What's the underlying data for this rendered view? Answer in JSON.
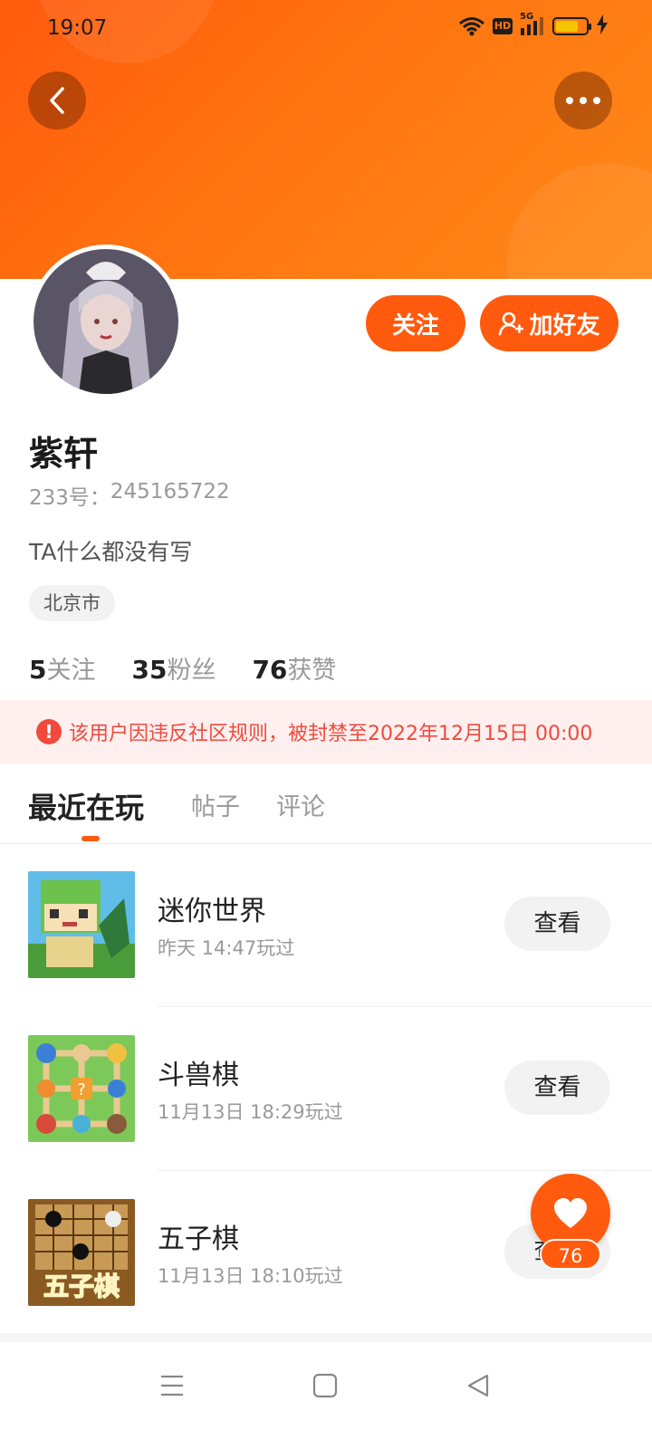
{
  "status_bar": {
    "time": "19:07",
    "network": "5G",
    "hd_label": "HD",
    "battery_level": 0.75,
    "icons": [
      "wifi-icon",
      "hd-icon",
      "signal-icon",
      "battery-icon",
      "charging-icon"
    ]
  },
  "header": {
    "back_icon": "chevron-left-icon",
    "more_icon": "more-dots-icon"
  },
  "profile": {
    "nickname": "紫轩",
    "uid_label": "233号：",
    "uid_value": "245165722",
    "bio": "TA什么都没有写",
    "location": "北京市",
    "follow_label": "关注",
    "add_friend_label": "加好友",
    "add_friend_icon": "add-user-icon"
  },
  "stats": [
    {
      "num": "5",
      "label": "关注"
    },
    {
      "num": "35",
      "label": "粉丝"
    },
    {
      "num": "76",
      "label": "获赞"
    }
  ],
  "ban_notice": {
    "icon": "alert-icon",
    "icon_glyph": "!",
    "text": "该用户因违反社区规则，被封禁至2022年12月15日 00:00"
  },
  "tabs": [
    {
      "label": "最近在玩",
      "active": true
    },
    {
      "label": "帖子",
      "active": false
    },
    {
      "label": "评论",
      "active": false
    }
  ],
  "games": [
    {
      "name": "迷你世界",
      "time": "昨天 14:47玩过",
      "button": "查看"
    },
    {
      "name": "斗兽棋",
      "time": "11月13日 18:29玩过",
      "button": "查看"
    },
    {
      "name": "五子棋",
      "time": "11月13日 18:10玩过",
      "button": "查看"
    }
  ],
  "gomoku_logo_text": "五子棋",
  "like_fab": {
    "icon": "heart-icon",
    "count": "76"
  },
  "nav": {
    "icons": [
      "menu-icon",
      "home-square-icon",
      "back-triangle-icon"
    ]
  },
  "colors": {
    "accent": "#ff5a0d",
    "header_gradient_start": "#ff5a0d",
    "header_gradient_end": "#ff8a1a",
    "ban_text": "#f04a3e",
    "ban_bg": "#fff0ef"
  }
}
